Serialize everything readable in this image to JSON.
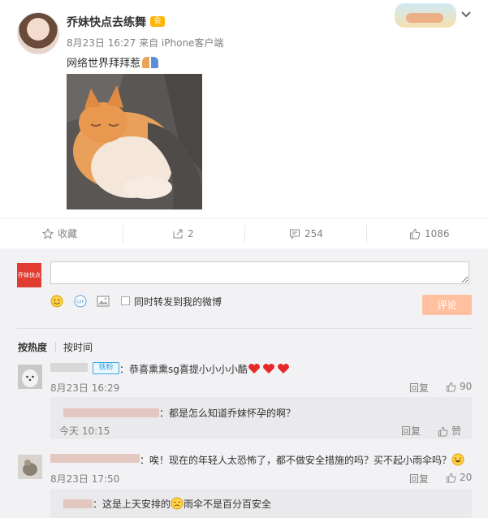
{
  "post": {
    "username": "乔妹快点去练舞",
    "vip_badge": "会",
    "meta": "8月23日 16:27 来自 iPhone客户端",
    "text": "网络世界拜拜惹"
  },
  "actions": {
    "favorite": "收藏",
    "forward_count": "2",
    "comment_count": "254",
    "like_count": "1086"
  },
  "composer": {
    "avatar_text": "乔妹快点",
    "forward_label": "同时转发到我的微博",
    "submit": "评论",
    "gif_label": "GIF"
  },
  "sort": {
    "hot": "按热度",
    "time": "按时间"
  },
  "comments": [
    {
      "badge": "铁粉",
      "text": "：恭喜熏熏sg喜提小小小小酷",
      "time": "8月23日 16:29",
      "reply": "回复",
      "likes": "90",
      "sub": {
        "text": "：都是怎么知道乔妹怀孕的啊？",
        "time": "今天 10:15",
        "reply": "回复",
        "like": "赞"
      }
    },
    {
      "text": "：唉！现在的年轻人太恐怖了，都不做安全措施的吗？买不起小雨伞吗？",
      "time": "8月23日 17:50",
      "reply": "回复",
      "likes": "20",
      "sub": {
        "name": "：",
        "text1": "这是上天安排的",
        "text2": "雨伞不是百分百安全"
      }
    }
  ],
  "colors": {
    "orange": "#eb7350",
    "submit_disabled": "#ffc09f",
    "fan_blue": "#3ba6e4"
  }
}
